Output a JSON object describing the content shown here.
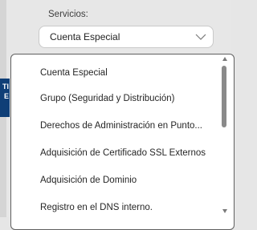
{
  "form": {
    "field_label": "Servicios:",
    "select_value": "Cuenta Especial",
    "chevron_icon": "chevron-down-icon"
  },
  "background": {
    "accent_fragment": [
      "TI",
      "E"
    ]
  },
  "dropdown": {
    "options": [
      "Cuenta Especial",
      "Grupo (Seguridad y Distribución)",
      "Derechos de Administración en Punto...",
      "Adquisición de Certificado SSL Externos",
      "Adquisición de Dominio",
      "Registro en el DNS interno."
    ],
    "scrollbar": {
      "up_icon": "scroll-up-arrow-icon",
      "down_icon": "scroll-down-arrow-icon"
    }
  },
  "colors": {
    "accent": "#0f3f77",
    "dropdown_border": "#5f5f5f",
    "select_border": "#c9c9c9"
  }
}
